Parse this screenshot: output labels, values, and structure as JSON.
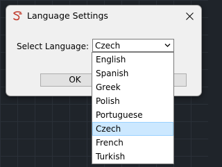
{
  "dialog": {
    "title": "Language Settings",
    "icon": "app-logo-icon",
    "close_icon": "close-icon"
  },
  "form": {
    "label": "Select Language:",
    "selected_value": "Czech",
    "ok_label": "OK"
  },
  "dropdown": {
    "options": [
      "English",
      "Spanish",
      "Greek",
      "Polish",
      "Portuguese",
      "Czech",
      "French",
      "Turkish"
    ],
    "highlighted": "Czech"
  },
  "colors": {
    "highlight": "#cce8ff",
    "highlight_border": "#99d1ff",
    "logo": "#c0392b"
  }
}
